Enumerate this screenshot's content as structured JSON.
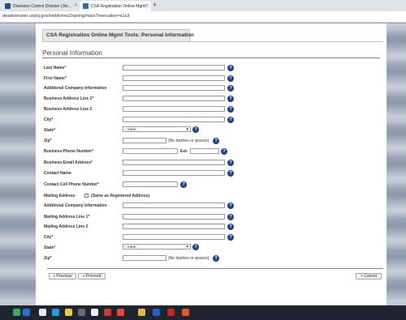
{
  "browser": {
    "tabs": [
      {
        "label": "Diversion Control Division | Re..."
      },
      {
        "label": "CSA Registration Online Mgmt..."
      }
    ],
    "new_tab": "+",
    "close": "×",
    "url": "deadiversion.usdoj.gov/webforms2/spring/main?execution=e1s3"
  },
  "panel": {
    "header": "CSA Registration Online Mgmt Tools: Personal Information",
    "section_title": "Personal Information"
  },
  "form": {
    "last_name": "Last Name*",
    "first_name": "First Name*",
    "additional_company": "Additional Company Information",
    "business_addr1": "Business Address Line 1*",
    "business_addr2": "Business Address Line 2",
    "city": "City*",
    "state": "State*",
    "state_placeholder": "- State -",
    "zip": "Zip*",
    "zip_note": "(No dashes or spaces)",
    "business_phone": "Business Phone Number*",
    "ext": "Ext.",
    "business_email": "Business Email Address*",
    "contact_name": "Contact Name",
    "contact_cell": "Contact Cell Phone Number*",
    "mailing_address": "Mailing Address",
    "same_as_registered": "(Same as Registered Address)",
    "mail_additional_company": "Additional Company Information",
    "mail_addr1": "Mailing Address Line 1*",
    "mail_addr2": "Mailing Address Line 2",
    "mail_city": "City*",
    "mail_state": "State*",
    "mail_state_placeholder": "- State -",
    "mail_zip": "Zip*",
    "mail_zip_note": "(No dashes or spaces)",
    "help": "?"
  },
  "buttons": {
    "previous": "« Previous",
    "proceed": "» Proceed",
    "cancel": "× Cancel"
  },
  "colors": {
    "help_icon": "#1f3f8f",
    "section_title": "#5a3a2a"
  }
}
